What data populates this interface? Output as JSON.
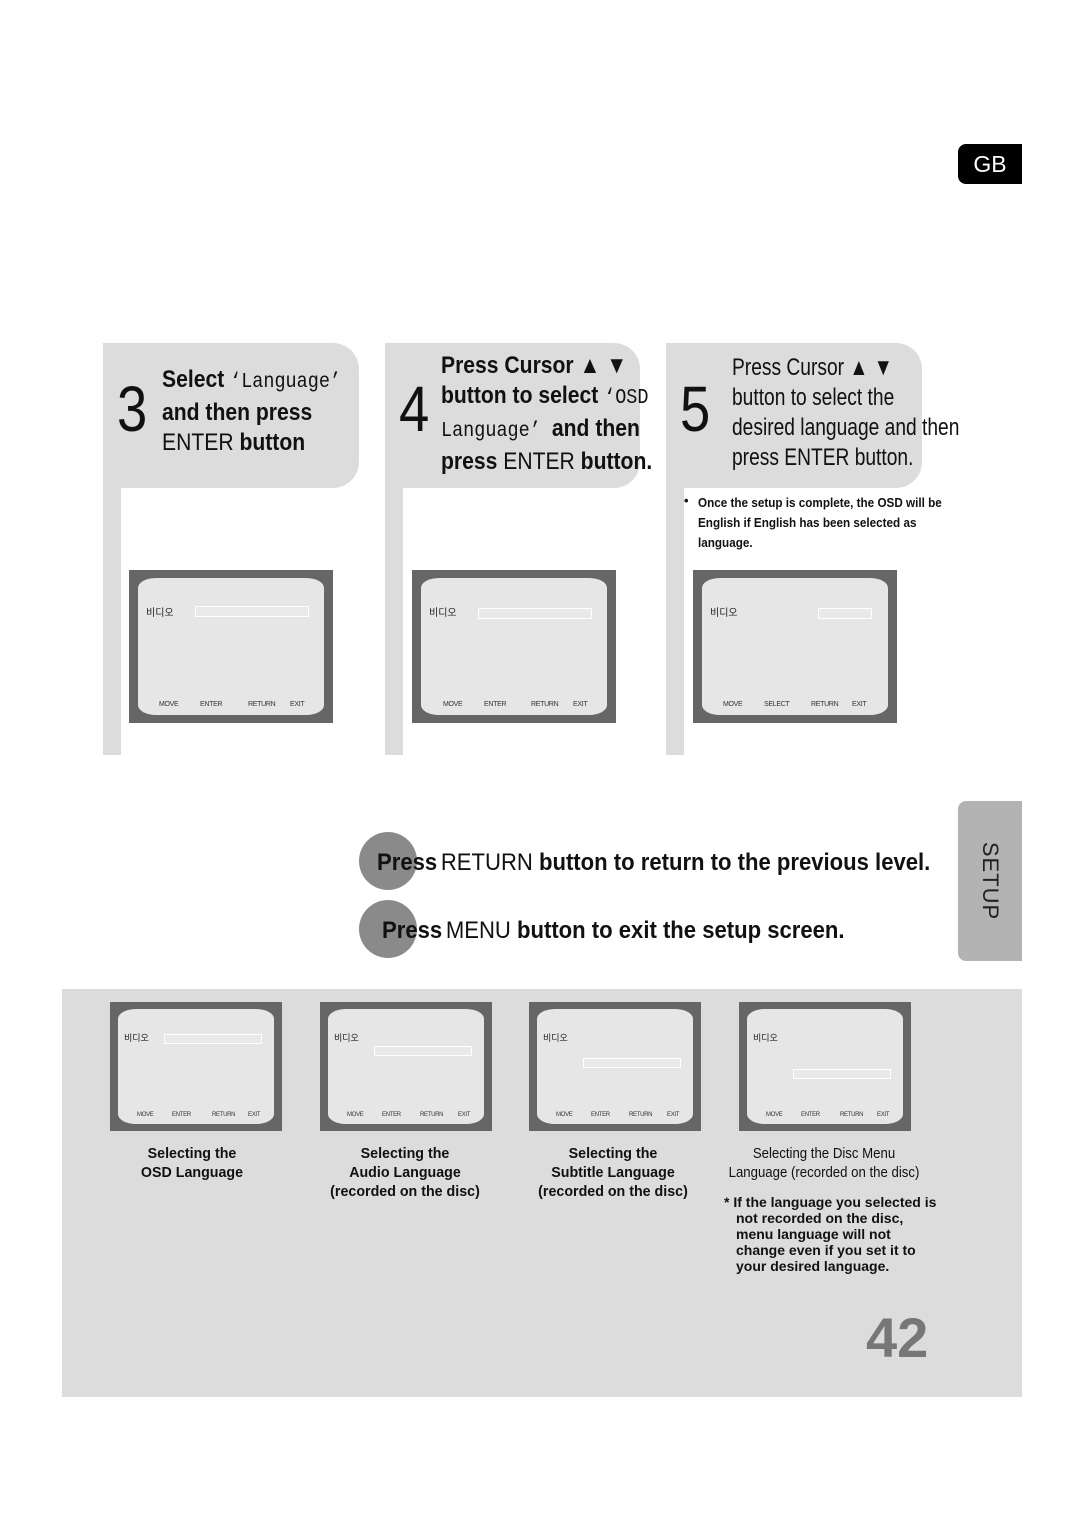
{
  "region_tab": "GB",
  "section_tab": "SETUP",
  "page_number": "42",
  "steps": [
    {
      "number": "3",
      "lines": [
        [
          {
            "t": "Select ",
            "s": "b"
          },
          {
            "t": "‘Language’",
            "s": "m"
          }
        ],
        [
          {
            "t": "and then press",
            "s": "b"
          }
        ],
        [
          {
            "t": "ENTER ",
            "s": "p"
          },
          {
            "t": "button",
            "s": "b"
          }
        ]
      ],
      "screen": {
        "label": "비디오",
        "footer": [
          "MOVE",
          "ENTER",
          "RETURN",
          "EXIT"
        ]
      }
    },
    {
      "number": "4",
      "lines": [
        [
          {
            "t": "Press Cursor ",
            "s": "b"
          },
          {
            "t": "▲ ▼",
            "s": "b"
          }
        ],
        [
          {
            "t": "button to select ",
            "s": "b"
          },
          {
            "t": "‘OSD",
            "s": "m"
          }
        ],
        [
          {
            "t": "Language’ ",
            "s": "m"
          },
          {
            "t": "and then",
            "s": "b"
          }
        ],
        [
          {
            "t": "press ",
            "s": "b"
          },
          {
            "t": "ENTER ",
            "s": "p"
          },
          {
            "t": "button.",
            "s": "b"
          }
        ]
      ],
      "screen": {
        "label": "비디오",
        "footer": [
          "MOVE",
          "ENTER",
          "RETURN",
          "EXIT"
        ]
      }
    },
    {
      "number": "5",
      "lines": [
        [
          {
            "t": "Press Cursor ",
            "s": "p"
          },
          {
            "t": "▲ ▼",
            "s": "p"
          }
        ],
        [
          {
            "t": "button to select the",
            "s": "p"
          }
        ],
        [
          {
            "t": "desired language and then",
            "s": "p"
          }
        ],
        [
          {
            "t": "press ",
            "s": "p"
          },
          {
            "t": "ENTER ",
            "s": "p"
          },
          {
            "t": "button.",
            "s": "p"
          }
        ]
      ],
      "note": "Once the setup is complete, the OSD will be English if English has been selected as language.",
      "screen": {
        "label": "비디오",
        "footer": [
          "MOVE",
          "SELECT",
          "RETURN",
          "EXIT"
        ]
      }
    }
  ],
  "press_lines": [
    {
      "press": "Press",
      "key": "RETURN",
      "rest": " button to return to the previous level."
    },
    {
      "press": "Press",
      "key": "MENU",
      "rest": " button to exit the setup screen."
    }
  ],
  "bottom_screens": [
    {
      "label": "비디오",
      "footer": [
        "MOVE",
        "ENTER",
        "RETURN",
        "EXIT"
      ],
      "caption": [
        "Selecting the",
        "OSD Language"
      ],
      "bold": true
    },
    {
      "label": "비디오",
      "footer": [
        "MOVE",
        "ENTER",
        "RETURN",
        "EXIT"
      ],
      "caption": [
        "Selecting the",
        "Audio Language",
        "(recorded on the disc)"
      ],
      "bold": true
    },
    {
      "label": "비디오",
      "footer": [
        "MOVE",
        "ENTER",
        "RETURN",
        "EXIT"
      ],
      "caption": [
        "Selecting the",
        "Subtitle Language",
        "(recorded on the disc)"
      ],
      "bold": true
    },
    {
      "label": "비디오",
      "footer": [
        "MOVE",
        "ENTER",
        "RETURN",
        "EXIT"
      ],
      "caption": [
        "Selecting the Disc Menu",
        "Language (recorded on the disc)"
      ],
      "bold": false
    }
  ],
  "footnote": "* If the language you selected is not recorded on the disc, menu language will not change even if you set it to your desired language."
}
